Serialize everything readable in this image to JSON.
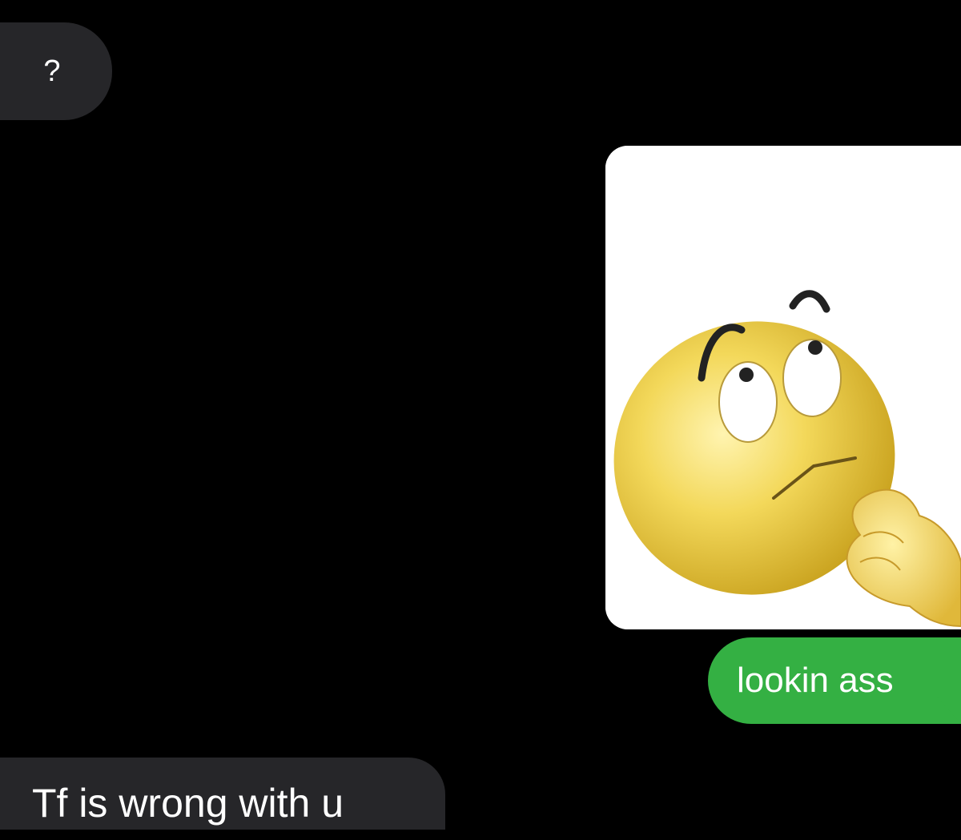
{
  "conversation": {
    "messages": [
      {
        "sender": "them",
        "text": "?"
      },
      {
        "sender": "me",
        "type": "image",
        "icon": "thinking-face-emoji"
      },
      {
        "sender": "me",
        "text": "lookin ass"
      },
      {
        "sender": "them",
        "text": "Tf is wrong with u"
      }
    ]
  },
  "colors": {
    "background": "#000000",
    "incoming_bubble": "#262629",
    "outgoing_bubble": "#34b043",
    "text": "#ffffff"
  }
}
